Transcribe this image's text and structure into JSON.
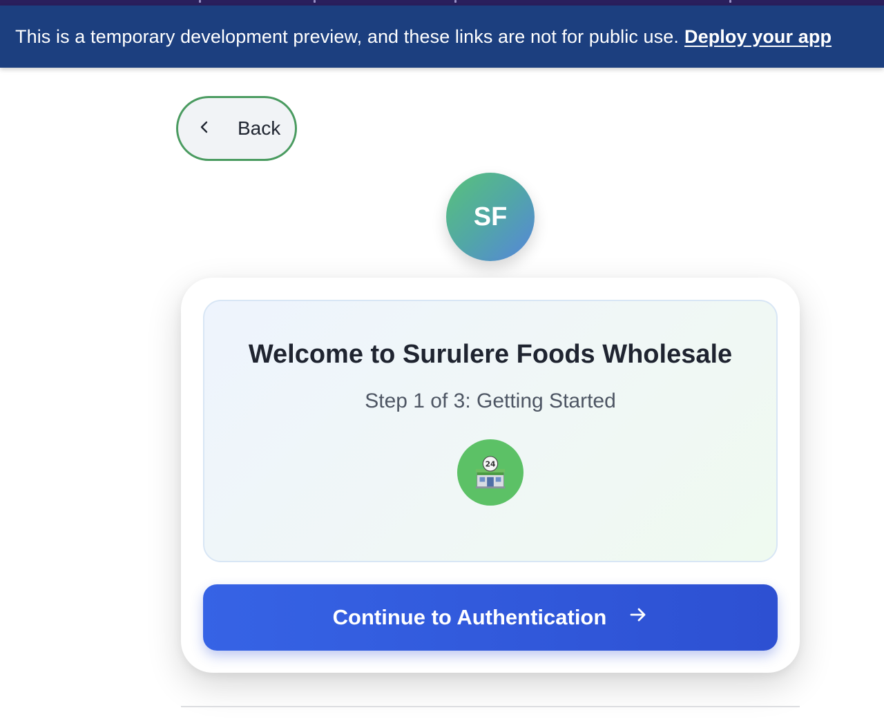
{
  "banner": {
    "message": "This is a temporary development preview, and these links are not for public use.",
    "link_label": "Deploy your app",
    "background": "#1c3f7f"
  },
  "nav": {
    "back_label": "Back",
    "back_icon": "chevron-left-icon",
    "back_border_color": "#4a9b60"
  },
  "brand": {
    "initials": "SF"
  },
  "welcome": {
    "title": "Welcome to Surulere Foods Wholesale",
    "step_text": "Step 1 of 3: Getting Started",
    "icon": "convenience-store-icon"
  },
  "actions": {
    "continue_label": "Continue to Authentication",
    "continue_icon": "arrow-right-icon",
    "accent": "#3663e5"
  }
}
